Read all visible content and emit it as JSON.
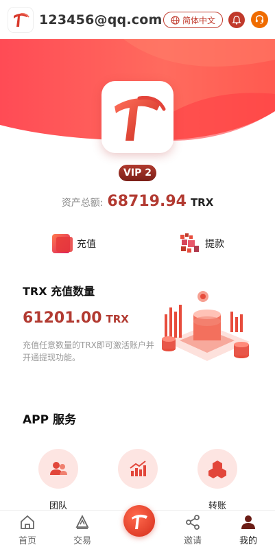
{
  "header": {
    "username": "123456@qq.com",
    "language": "简体中文"
  },
  "profile": {
    "vip_level": "VIP 2",
    "assets_label": "资产总额:",
    "assets_value": "68719.94",
    "assets_unit": "TRX"
  },
  "actions": {
    "recharge_label": "充值",
    "withdraw_label": "提款"
  },
  "trx_card": {
    "title": "TRX 充值数量",
    "amount": "61201.00",
    "unit": "TRX",
    "description": "充值任意数量的TRX即可激活账户并开通提现功能。"
  },
  "services": {
    "title": "APP 服务",
    "items": [
      {
        "label": "团队",
        "icon": "team-icon"
      },
      {
        "label": "",
        "icon": "stats-icon"
      },
      {
        "label": "转账",
        "icon": "transfer-icon"
      }
    ]
  },
  "nav": {
    "items": [
      {
        "label": "首页",
        "icon": "home-icon"
      },
      {
        "label": "交易",
        "icon": "trade-icon"
      },
      {
        "label": "",
        "icon": "logo-icon"
      },
      {
        "label": "邀请",
        "icon": "share-icon"
      },
      {
        "label": "我的",
        "icon": "user-icon"
      }
    ]
  },
  "colors": {
    "accent": "#b23a31",
    "banner": "#ff5b5b",
    "badge": "#8b2a22",
    "support": "#ef6c00"
  }
}
